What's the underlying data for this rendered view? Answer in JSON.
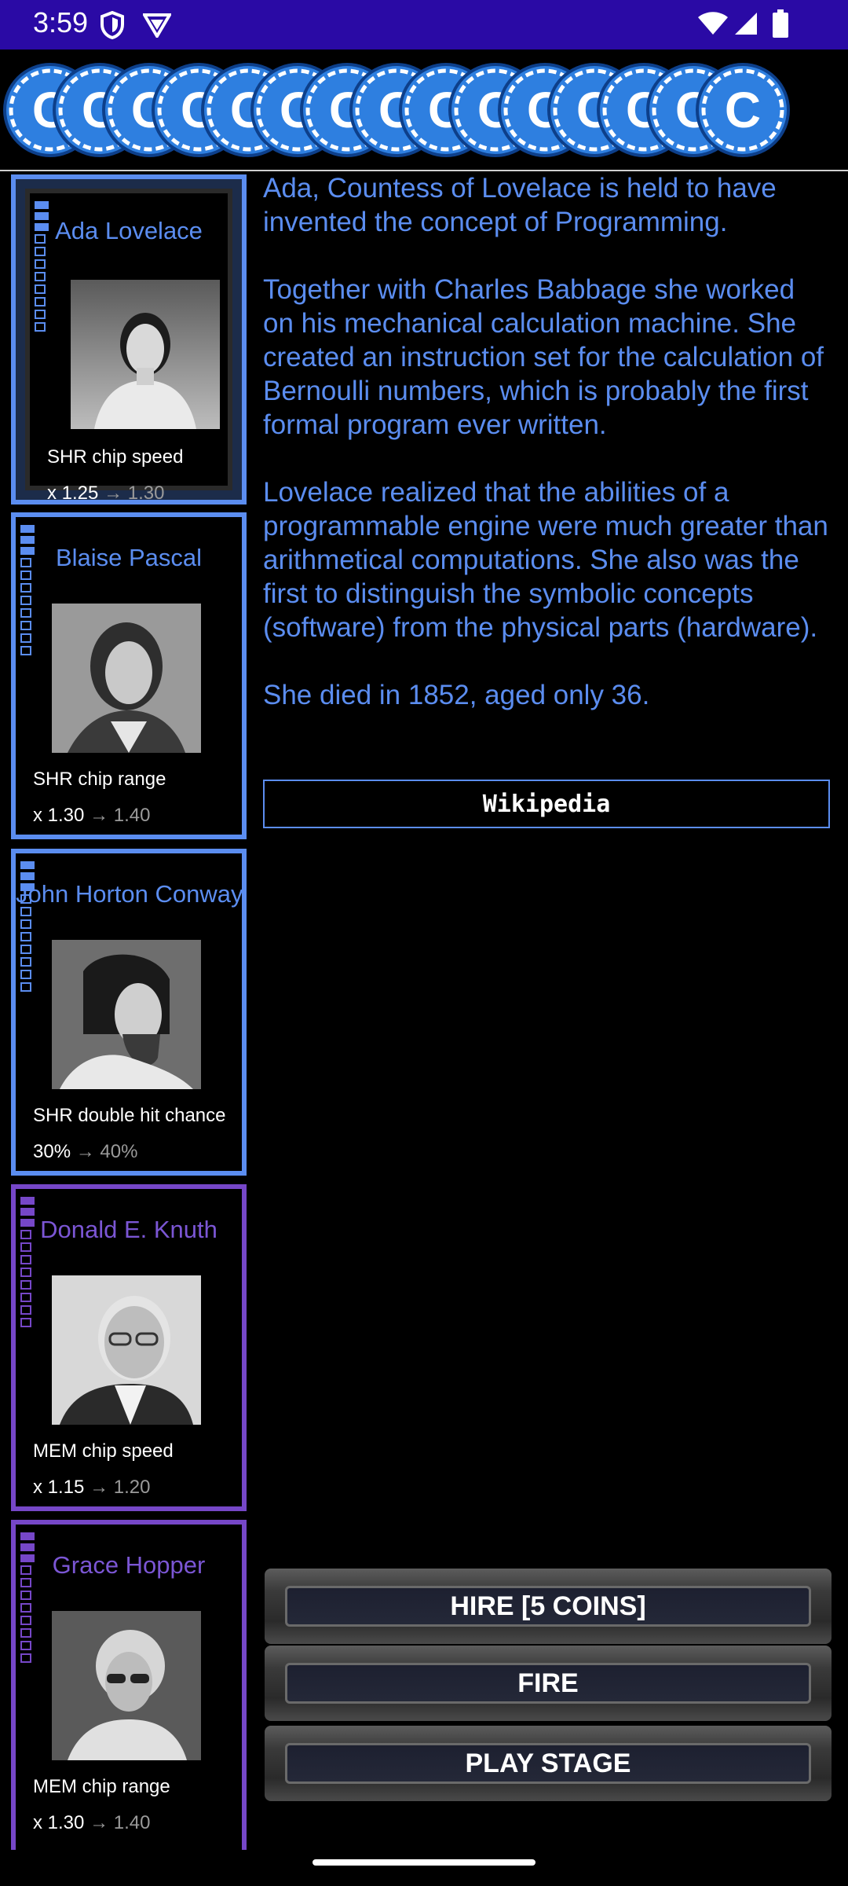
{
  "status_bar": {
    "time": "3:59",
    "icons": [
      "shield-icon",
      "vpn-icon",
      "wifi-icon",
      "signal-icon",
      "battery-icon"
    ]
  },
  "coin_bar": {
    "coin_count_visible": 15,
    "coin_letter": "C",
    "coin_color": "#2e7fe0"
  },
  "cards": [
    {
      "name": "Ada Lovelace",
      "stat_label": "SHR chip speed",
      "stat_value": "x 1.25",
      "stat_next": "→ 1.30",
      "color": "#5b8df0",
      "selected": true
    },
    {
      "name": "Blaise Pascal",
      "stat_label": "SHR chip range",
      "stat_value": "x 1.30",
      "stat_next": "→ 1.40",
      "color": "#5b8df0"
    },
    {
      "name": "John Horton Conway",
      "stat_label": "SHR double hit chance",
      "stat_value": "30%",
      "stat_next": "→ 40%",
      "color": "#5b8df0"
    },
    {
      "name": "Donald E. Knuth",
      "stat_label": "MEM chip speed",
      "stat_value": "x 1.15",
      "stat_next": "→ 1.20",
      "color": "#7647c8"
    },
    {
      "name": "Grace Hopper",
      "stat_label": "MEM chip range",
      "stat_value": "x 1.30",
      "stat_next": "→ 1.40",
      "color": "#7647c8"
    }
  ],
  "info": {
    "paragraphs": [
      "Ada, Countess of Lovelace is held to have invented the concept of Programming.",
      "Together with Charles Babbage she worked on his mechanical calculation machine. She created an instruction set for the calculation of Bernoulli numbers, which is probably the first formal program ever written.",
      "Lovelace realized that the abilities of a programmable engine were much greater than arithmetical computations. She also was the first to distinguish the symbolic concepts (software) from the physical parts (hardware).",
      "She died in 1852, aged only 36."
    ],
    "wiki_label": "Wikipedia"
  },
  "actions": {
    "hire_label": "HIRE [5 COINS]",
    "fire_label": "FIRE",
    "play_label": "PLAY STAGE"
  }
}
